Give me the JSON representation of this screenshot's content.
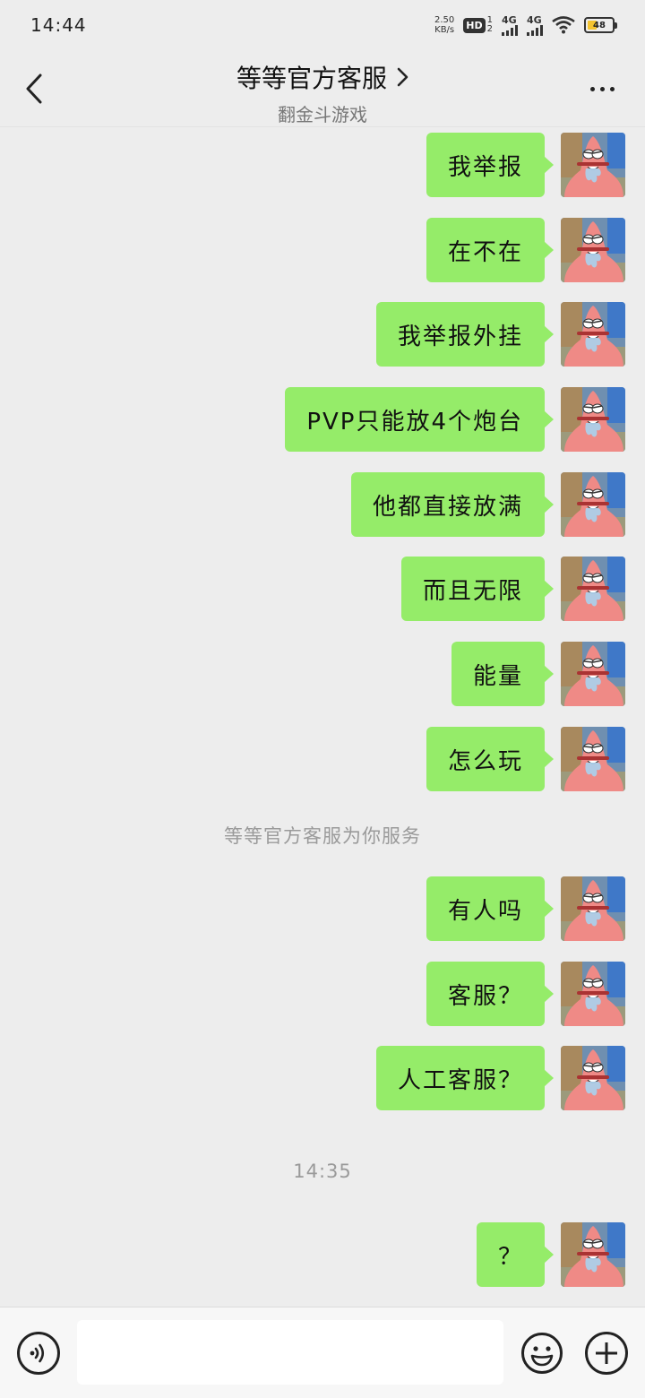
{
  "status_bar": {
    "time": "14:44",
    "net_speed_value": "2.50",
    "net_speed_unit": "KB/s",
    "hd_label": "HD",
    "hd_sub_top": "1",
    "hd_sub_bottom": "2",
    "signal1_label": "4G",
    "signal2_label": "4G",
    "battery_level": "48",
    "icons": [
      "wifi-icon",
      "battery-icon"
    ]
  },
  "header": {
    "title": "等等官方客服",
    "subtitle": "翻金斗游戏",
    "back_icon": "chevron-left-icon",
    "title_arrow_icon": "chevron-right-icon",
    "more_icon": "more-dots-icon"
  },
  "messages": [
    {
      "text": "我举报"
    },
    {
      "text": "在不在"
    },
    {
      "text": "我举报外挂"
    },
    {
      "text": "PVP只能放4个炮台"
    },
    {
      "text": "他都直接放满"
    },
    {
      "text": "而且无限"
    },
    {
      "text": "能量"
    },
    {
      "text": "怎么玩"
    },
    {
      "text": "有人吗"
    },
    {
      "text": "客服？"
    },
    {
      "text": "人工客服？"
    },
    {
      "text": "？"
    }
  ],
  "system_notices": {
    "service_notice": "等等官方客服为你服务",
    "timestamp": "14:35"
  },
  "input_bar": {
    "value": "",
    "placeholder": "",
    "voice_icon": "voice-icon",
    "emoji_icon": "emoji-icon",
    "plus_icon": "plus-icon"
  },
  "colors": {
    "bubble": "#95ec69",
    "background": "#ededed",
    "input_bar": "#f7f7f7",
    "system_text": "#9a9a9a"
  }
}
